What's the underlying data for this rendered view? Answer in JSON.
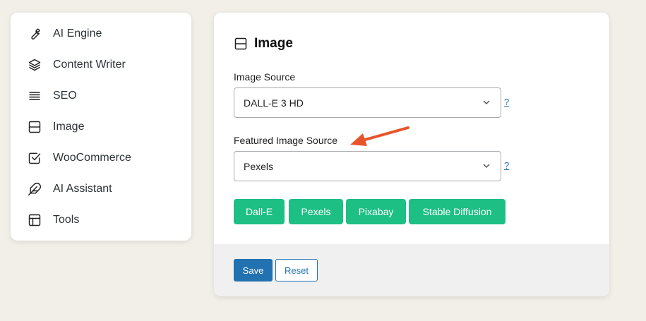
{
  "sidebar": {
    "items": [
      {
        "label": "AI Engine",
        "icon": "wrench-icon"
      },
      {
        "label": "Content Writer",
        "icon": "layers-icon"
      },
      {
        "label": "SEO",
        "icon": "lines-icon"
      },
      {
        "label": "Image",
        "icon": "image-panel-icon"
      },
      {
        "label": "WooCommerce",
        "icon": "checkbox-icon"
      },
      {
        "label": "AI Assistant",
        "icon": "feather-icon"
      },
      {
        "label": "Tools",
        "icon": "layout-icon"
      }
    ]
  },
  "panel": {
    "title": "Image",
    "image_source": {
      "label": "Image Source",
      "value": "DALL-E 3 HD",
      "help": "?"
    },
    "featured_source": {
      "label": "Featured Image Source",
      "value": "Pexels",
      "help": "?"
    },
    "source_buttons": [
      "Dall-E",
      "Pexels",
      "Pixabay",
      "Stable Diffusion"
    ]
  },
  "footer": {
    "save_label": "Save",
    "reset_label": "Reset"
  },
  "colors": {
    "accent_green": "#1dbf84",
    "primary_blue": "#2271b1",
    "annotation_arrow": "#e8542a"
  }
}
